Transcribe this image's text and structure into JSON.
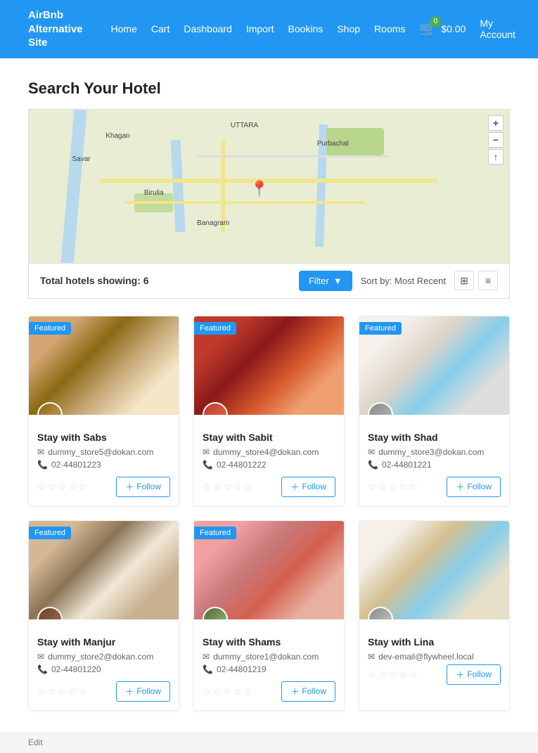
{
  "header": {
    "brand_line1": "AirBnb",
    "brand_line2": "Alternative Site",
    "nav": [
      "Home",
      "Cart",
      "Dashboard",
      "Import",
      "Bookins",
      "Shop",
      "Rooms"
    ],
    "cart_price": "$0.00",
    "cart_badge": "0",
    "my_account": "My Account"
  },
  "page": {
    "title": "Search Your Hotel"
  },
  "filter_bar": {
    "total_label": "Total hotels",
    "showing_label": "showing:",
    "showing_count": "6",
    "filter_btn": "Filter",
    "sort_label": "Sort by: Most Recent"
  },
  "hotels": [
    {
      "name": "Stay with Sabs",
      "email": "dummy_store5@dokan.com",
      "phone": "02-44801223",
      "featured": true,
      "img_class": "img-sabs",
      "av_class": "av1"
    },
    {
      "name": "Stay with Sabit",
      "email": "dummy_store4@dokan.com",
      "phone": "02-44801222",
      "featured": true,
      "img_class": "img-sabit",
      "av_class": "av2"
    },
    {
      "name": "Stay with Shad",
      "email": "dummy_store3@dokan.com",
      "phone": "02-44801221",
      "featured": true,
      "img_class": "img-shad",
      "av_class": "av3"
    },
    {
      "name": "Stay with Manjur",
      "email": "dummy_store2@dokan.com",
      "phone": "02-44801220",
      "featured": true,
      "img_class": "img-manjur",
      "av_class": "av4"
    },
    {
      "name": "Stay with Shams",
      "email": "dummy_store1@dokan.com",
      "phone": "02-44801219",
      "featured": true,
      "img_class": "img-shams",
      "av_class": "av5"
    },
    {
      "name": "Stay with Lina",
      "email": "dev-email@flywheel.local",
      "phone": "",
      "featured": false,
      "img_class": "img-lina",
      "av_class": "av6"
    }
  ],
  "footer": {
    "edit_label": "Edit"
  },
  "icons": {
    "email": "✉",
    "phone": "📞",
    "follow": "＋",
    "filter_arrow": "▼",
    "grid_view": "⊞",
    "list_view": "≡",
    "cart": "🛒",
    "map_plus": "+",
    "map_minus": "−",
    "map_arrow": "↑"
  }
}
